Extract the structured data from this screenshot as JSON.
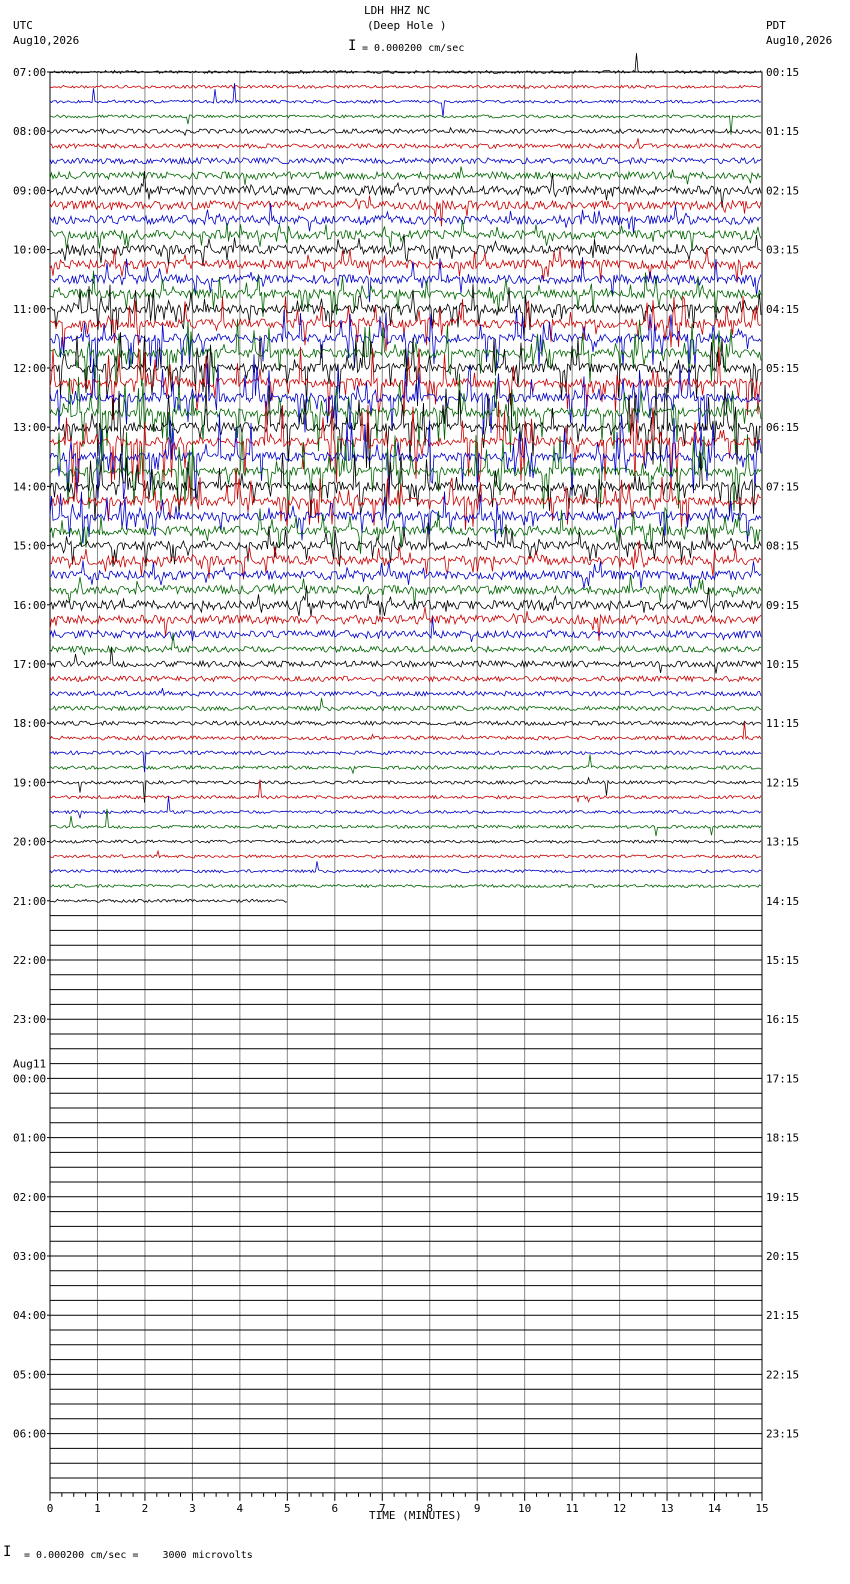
{
  "header": {
    "station": "LDH HHZ NC",
    "site": "(Deep Hole )",
    "left_zone": "UTC",
    "left_date": "Aug10,2026",
    "right_zone": "PDT",
    "right_date": "Aug10,2026",
    "scale_text": "= 0.000200 cm/sec"
  },
  "footer": {
    "xlabel": "TIME (MINUTES)",
    "scale_text": "= 0.000200 cm/sec =    3000 microvolts"
  },
  "chart_data": {
    "type": "line",
    "title": "LDH HHZ NC (Deep Hole )",
    "xlabel": "TIME (MINUTES)",
    "xlim": [
      0,
      15
    ],
    "x_ticks": [
      "0",
      "1",
      "2",
      "3",
      "4",
      "5",
      "6",
      "7",
      "8",
      "9",
      "10",
      "11",
      "12",
      "13",
      "14",
      "15"
    ],
    "trace_colors": [
      "#000000",
      "#cc0000",
      "#0000cc",
      "#006600"
    ],
    "rows_per_hour": 4,
    "active_rows": 57,
    "last_row_end_minute": 5,
    "left_hour_labels": [
      "07:00",
      "08:00",
      "09:00",
      "10:00",
      "11:00",
      "12:00",
      "13:00",
      "14:00",
      "15:00",
      "16:00",
      "17:00",
      "18:00",
      "19:00",
      "20:00",
      "21:00",
      "22:00",
      "23:00",
      "00:00",
      "01:00",
      "02:00",
      "03:00",
      "04:00",
      "05:00",
      "06:00"
    ],
    "left_date_change": {
      "hour_index": 17,
      "label": "Aug11"
    },
    "right_hour_labels": [
      "00:15",
      "01:15",
      "02:15",
      "03:15",
      "04:15",
      "05:15",
      "06:15",
      "07:15",
      "08:15",
      "09:15",
      "10:15",
      "11:15",
      "12:15",
      "13:15",
      "14:15",
      "15:15",
      "16:15",
      "17:15",
      "18:15",
      "19:15",
      "20:15",
      "21:15",
      "22:15",
      "23:15"
    ],
    "amplitude_profile": [
      1,
      1,
      1,
      1,
      1.5,
      1.5,
      2,
      2.5,
      3,
      3.5,
      4,
      5,
      6,
      7,
      8,
      9,
      10,
      11,
      12,
      13,
      14,
      15,
      16,
      16,
      17,
      17,
      17,
      17,
      14,
      12,
      10,
      9,
      8,
      7,
      6,
      5,
      4,
      3,
      2.5,
      2,
      2,
      1.8,
      1.6,
      1.5,
      1.4,
      1.3,
      1.2,
      1.2,
      1.1,
      1.1,
      1,
      1,
      1,
      1,
      1,
      1,
      1
    ]
  }
}
